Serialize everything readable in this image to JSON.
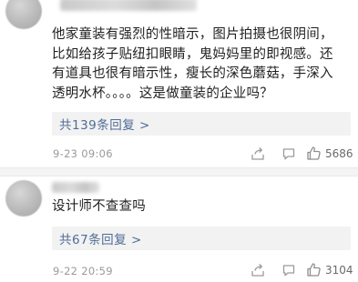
{
  "comments": [
    {
      "text_lines": [
        "他家童装有强烈的性暗示，图片拍摄也很阴间，",
        "比如给孩子贴纽扣眼睛，鬼妈妈里的即视感。还",
        "有道具也很有暗示性，瘦长的深色蘑菇，手深入",
        "透明水杯。。。。这是做童装的企业吗？"
      ],
      "reply_link": "共139条回复 >",
      "timestamp": "9-23 09:06",
      "likes": "5686",
      "icons": [
        "share-icon",
        "comment-icon",
        "like-icon"
      ]
    },
    {
      "text_lines": [
        "设计师不查查吗"
      ],
      "reply_link": "共67条回复 >",
      "timestamp": "9-22 20:59",
      "likes": "3104",
      "icons": [
        "share-icon",
        "comment-icon",
        "like-icon"
      ]
    }
  ],
  "colors": {
    "reply_link": "#4f6c96",
    "meta_text": "#9a9a9a",
    "reply_background": "#f2f2f2"
  }
}
